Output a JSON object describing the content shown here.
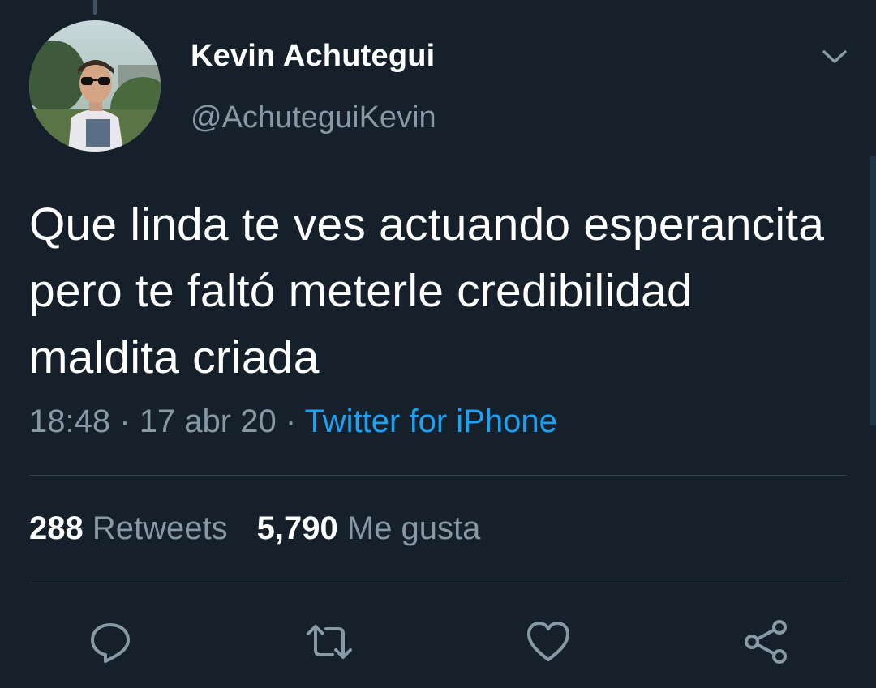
{
  "tweet": {
    "author": {
      "display_name": "Kevin Achutegui",
      "handle": "@AchuteguiKevin"
    },
    "text": "Que linda te ves actuando esperancita pero te faltó meterle credibilidad maldita criada",
    "time": "18:48",
    "separator": "·",
    "date": "17 abr 20",
    "source": "Twitter for iPhone",
    "stats": {
      "retweets_count": "288",
      "retweets_label": "Retweets",
      "likes_count": "5,790",
      "likes_label": "Me gusta"
    }
  },
  "icons": {
    "caret": "chevron-down-icon",
    "reply": "reply-icon",
    "retweet": "retweet-icon",
    "like": "heart-icon",
    "share": "share-icon"
  },
  "colors": {
    "background": "#15202b",
    "primary_text": "#ffffff",
    "secondary_text": "#8899a6",
    "accent": "#1da1f2",
    "divider": "#38444d"
  }
}
